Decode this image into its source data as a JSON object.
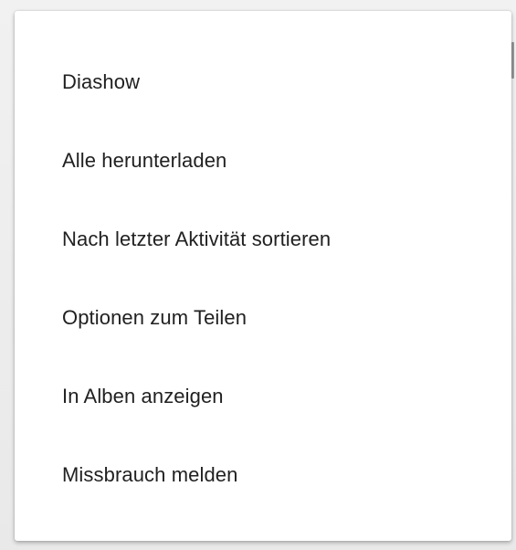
{
  "menu": {
    "items": [
      {
        "label": "Diashow"
      },
      {
        "label": "Alle herunterladen"
      },
      {
        "label": "Nach letzter Aktivität sortieren"
      },
      {
        "label": "Optionen zum Teilen"
      },
      {
        "label": "In Alben anzeigen"
      },
      {
        "label": "Missbrauch melden"
      }
    ]
  }
}
